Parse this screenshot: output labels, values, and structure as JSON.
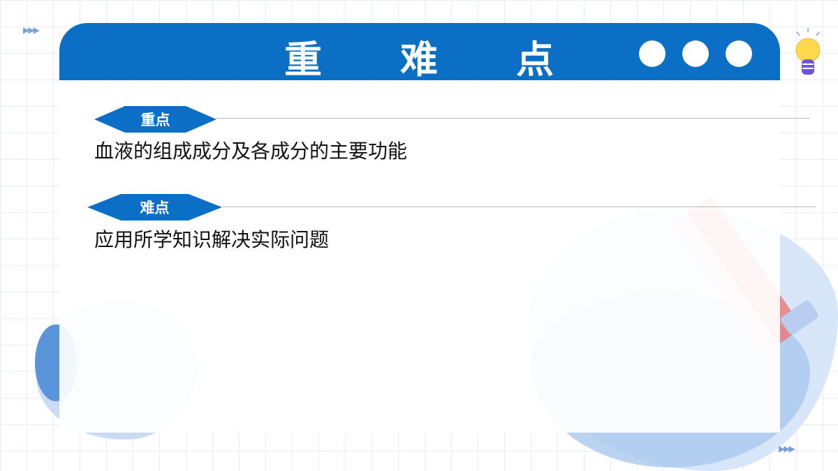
{
  "header": {
    "title_chars": [
      "重",
      "难",
      "点"
    ]
  },
  "sections": [
    {
      "tag": "重点",
      "text": "血液的组成成分及各成分的主要功能"
    },
    {
      "tag": "难点",
      "text": "应用所学知识解决实际问题"
    }
  ],
  "decor": {
    "arrows": "▶▶▶",
    "icons": [
      "lightbulb-icon",
      "pencil-icon"
    ]
  },
  "colors": {
    "accent": "#0b6fc6",
    "text": "#111111",
    "background": "#ffffff"
  }
}
